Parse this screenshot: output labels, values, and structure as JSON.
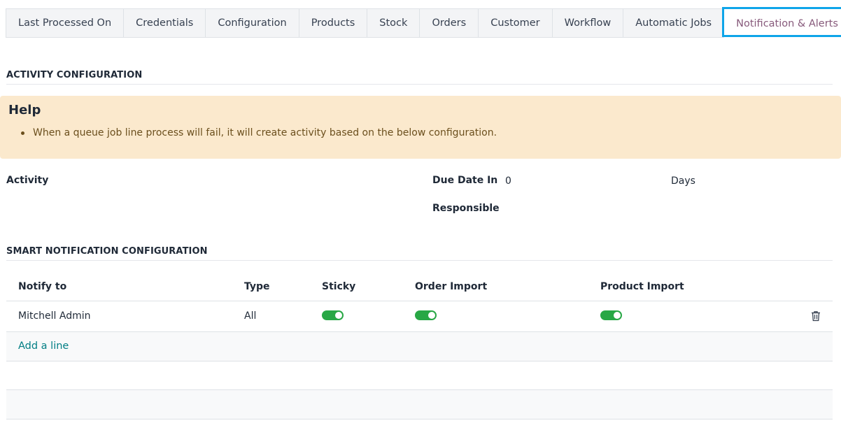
{
  "tabs": [
    {
      "label": "Last Processed On"
    },
    {
      "label": "Credentials"
    },
    {
      "label": "Configuration"
    },
    {
      "label": "Products"
    },
    {
      "label": "Stock"
    },
    {
      "label": "Orders"
    },
    {
      "label": "Customer"
    },
    {
      "label": "Workflow"
    },
    {
      "label": "Automatic Jobs"
    },
    {
      "label": "Notification & Alerts",
      "active": true
    }
  ],
  "activity_section": {
    "title": "ACTIVITY CONFIGURATION",
    "help_title": "Help",
    "help_text": "When a queue job line process will fail, it will create activity based on the below configuration.",
    "activity_label": "Activity",
    "due_date_label": "Due Date In",
    "due_date_value": "0",
    "due_date_unit": "Days",
    "responsible_label": "Responsible"
  },
  "smart_section": {
    "title": "SMART NOTIFICATION CONFIGURATION",
    "columns": [
      "Notify to",
      "Type",
      "Sticky",
      "Order Import",
      "Product Import"
    ],
    "rows": [
      {
        "notify_to": "Mitchell Admin",
        "type": "All",
        "sticky": true,
        "order_import": true,
        "product_import": true
      }
    ],
    "add_line_label": "Add a line"
  },
  "colors": {
    "accent": "#875a7b",
    "highlight_border": "#0ea5e9",
    "toggle_on": "#28a745",
    "link": "#017e84",
    "help_bg": "#fbe9cd"
  }
}
